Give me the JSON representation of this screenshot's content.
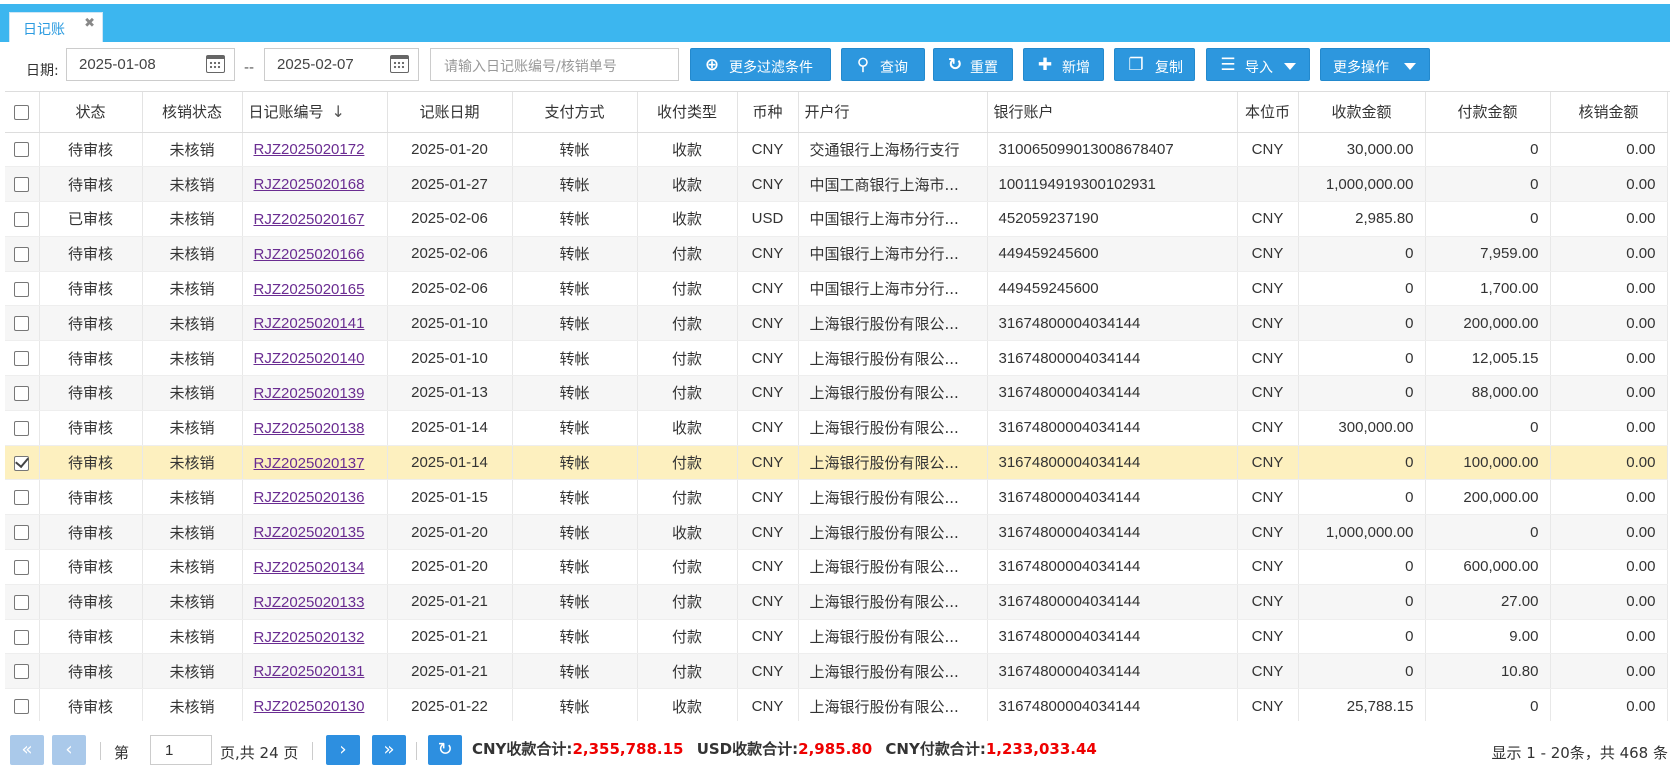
{
  "tab": {
    "label": "日记账",
    "close": "✖"
  },
  "filter": {
    "date_label": "日期:",
    "date_from": "2025-01-08",
    "date_sep": "--",
    "date_to": "2025-02-07",
    "search_placeholder": "请输入日记账编号/核销单号"
  },
  "toolbar": {
    "more_filters": "更多过滤条件",
    "query": "查询",
    "reset": "重置",
    "add": "新增",
    "copy": "复制",
    "import": "导入",
    "more_ops": "更多操作"
  },
  "columns": [
    "状态",
    "核销状态",
    "日记账编号",
    "记账日期",
    "支付方式",
    "收付类型",
    "币种",
    "开户行",
    "银行账户",
    "本位币",
    "收款金额",
    "付款金额",
    "核销金额"
  ],
  "rows": [
    [
      "待审核",
      "未核销",
      "RJZ2025020172",
      "2025-01-20",
      "转帐",
      "收款",
      "CNY",
      "交通银行上海杨行支行",
      "310065099013008678407",
      "CNY",
      "30,000.00",
      "0",
      "0.00"
    ],
    [
      "待审核",
      "未核销",
      "RJZ2025020168",
      "2025-01-27",
      "转帐",
      "收款",
      "CNY",
      "中国工商银行上海市...",
      "1001194919300102931",
      "",
      "1,000,000.00",
      "0",
      "0.00"
    ],
    [
      "已审核",
      "未核销",
      "RJZ2025020167",
      "2025-02-06",
      "转帐",
      "收款",
      "USD",
      "中国银行上海市分行...",
      "452059237190",
      "CNY",
      "2,985.80",
      "0",
      "0.00"
    ],
    [
      "待审核",
      "未核销",
      "RJZ2025020166",
      "2025-02-06",
      "转帐",
      "付款",
      "CNY",
      "中国银行上海市分行...",
      "449459245600",
      "CNY",
      "0",
      "7,959.00",
      "0.00"
    ],
    [
      "待审核",
      "未核销",
      "RJZ2025020165",
      "2025-02-06",
      "转帐",
      "付款",
      "CNY",
      "中国银行上海市分行...",
      "449459245600",
      "CNY",
      "0",
      "1,700.00",
      "0.00"
    ],
    [
      "待审核",
      "未核销",
      "RJZ2025020141",
      "2025-01-10",
      "转帐",
      "付款",
      "CNY",
      "上海银行股份有限公...",
      "31674800004034144",
      "CNY",
      "0",
      "200,000.00",
      "0.00"
    ],
    [
      "待审核",
      "未核销",
      "RJZ2025020140",
      "2025-01-10",
      "转帐",
      "付款",
      "CNY",
      "上海银行股份有限公...",
      "31674800004034144",
      "CNY",
      "0",
      "12,005.15",
      "0.00"
    ],
    [
      "待审核",
      "未核销",
      "RJZ2025020139",
      "2025-01-13",
      "转帐",
      "付款",
      "CNY",
      "上海银行股份有限公...",
      "31674800004034144",
      "CNY",
      "0",
      "88,000.00",
      "0.00"
    ],
    [
      "待审核",
      "未核销",
      "RJZ2025020138",
      "2025-01-14",
      "转帐",
      "收款",
      "CNY",
      "上海银行股份有限公...",
      "31674800004034144",
      "CNY",
      "300,000.00",
      "0",
      "0.00"
    ],
    [
      "待审核",
      "未核销",
      "RJZ2025020137",
      "2025-01-14",
      "转帐",
      "付款",
      "CNY",
      "上海银行股份有限公...",
      "31674800004034144",
      "CNY",
      "0",
      "100,000.00",
      "0.00"
    ],
    [
      "待审核",
      "未核销",
      "RJZ2025020136",
      "2025-01-15",
      "转帐",
      "付款",
      "CNY",
      "上海银行股份有限公...",
      "31674800004034144",
      "CNY",
      "0",
      "200,000.00",
      "0.00"
    ],
    [
      "待审核",
      "未核销",
      "RJZ2025020135",
      "2025-01-20",
      "转帐",
      "收款",
      "CNY",
      "上海银行股份有限公...",
      "31674800004034144",
      "CNY",
      "1,000,000.00",
      "0",
      "0.00"
    ],
    [
      "待审核",
      "未核销",
      "RJZ2025020134",
      "2025-01-20",
      "转帐",
      "付款",
      "CNY",
      "上海银行股份有限公...",
      "31674800004034144",
      "CNY",
      "0",
      "600,000.00",
      "0.00"
    ],
    [
      "待审核",
      "未核销",
      "RJZ2025020133",
      "2025-01-21",
      "转帐",
      "付款",
      "CNY",
      "上海银行股份有限公...",
      "31674800004034144",
      "CNY",
      "0",
      "27.00",
      "0.00"
    ],
    [
      "待审核",
      "未核销",
      "RJZ2025020132",
      "2025-01-21",
      "转帐",
      "付款",
      "CNY",
      "上海银行股份有限公...",
      "31674800004034144",
      "CNY",
      "0",
      "9.00",
      "0.00"
    ],
    [
      "待审核",
      "未核销",
      "RJZ2025020131",
      "2025-01-21",
      "转帐",
      "付款",
      "CNY",
      "上海银行股份有限公...",
      "31674800004034144",
      "CNY",
      "0",
      "10.80",
      "0.00"
    ],
    [
      "待审核",
      "未核销",
      "RJZ2025020130",
      "2025-01-22",
      "转帐",
      "收款",
      "CNY",
      "上海银行股份有限公...",
      "31674800004034144",
      "CNY",
      "25,788.15",
      "0",
      "0.00"
    ]
  ],
  "selected_row": 9,
  "pager": {
    "page_label_pre": "第",
    "page": "1",
    "page_label_post": "页,共 24 页",
    "summary": "显示 1 - 20条，共 468 条"
  },
  "totals": {
    "cny_in_label": "CNY收款合计:",
    "cny_in_value": "2,355,788.15",
    "usd_in_label": "USD收款合计:",
    "usd_in_value": "2,985.80",
    "cny_out_label": "CNY付款合计:",
    "cny_out_value": "1,233,033.44"
  },
  "colors": {
    "accent": "#3cb6ef",
    "button": "#2d97de",
    "selected_row": "#fdf0bf",
    "total_red": "#e00000",
    "link": "#6a2c91"
  }
}
